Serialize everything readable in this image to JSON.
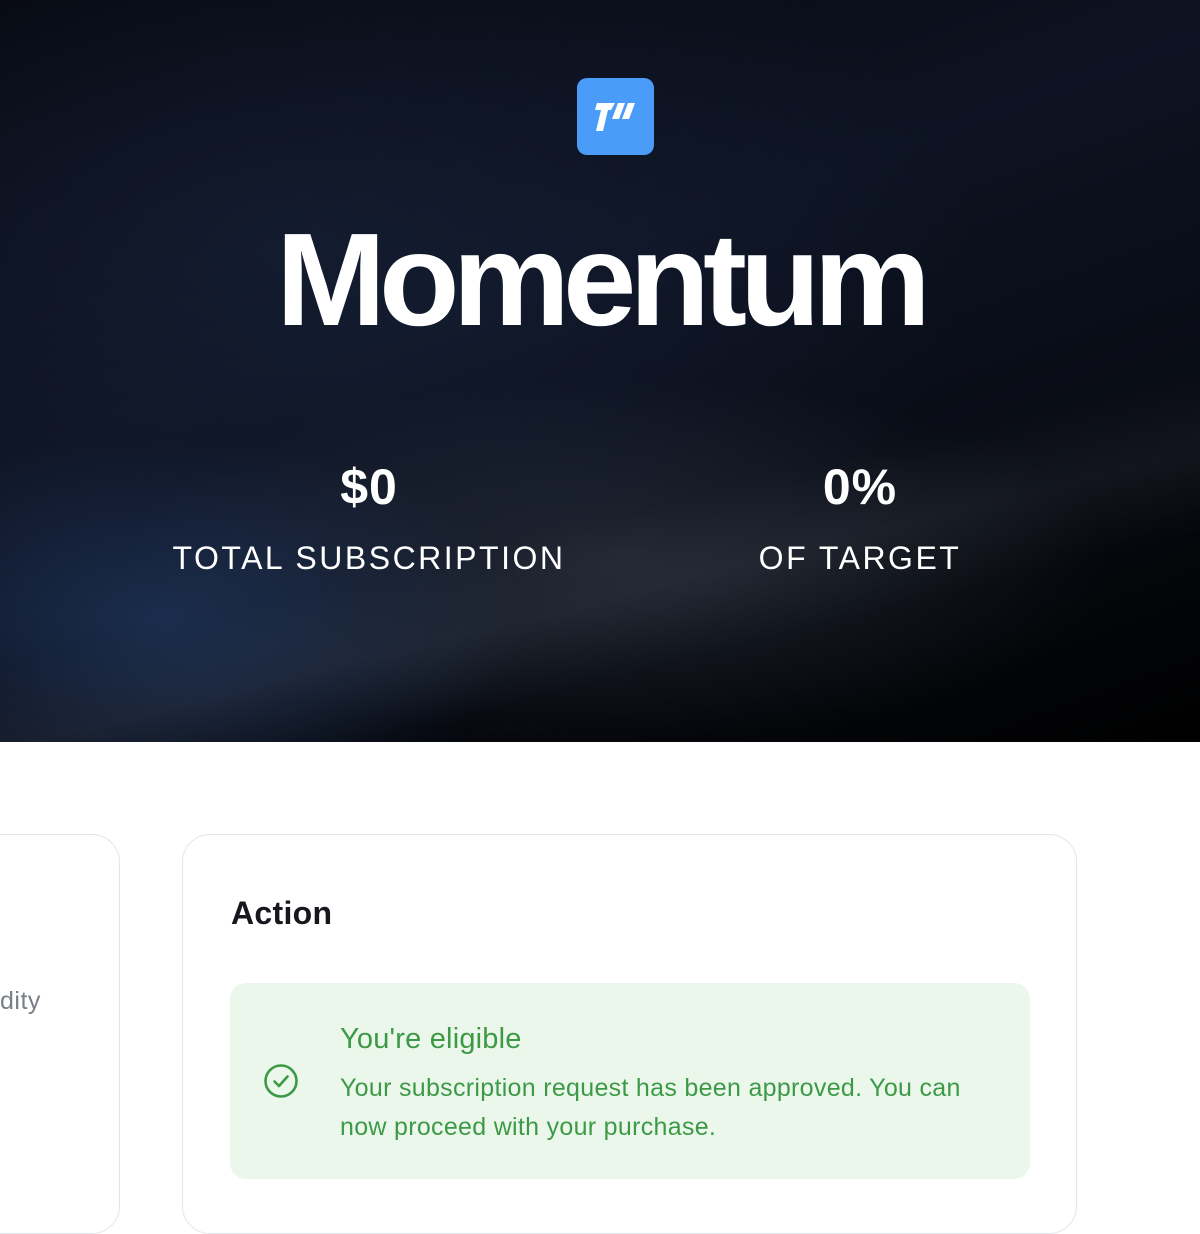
{
  "hero": {
    "logo_icon": "momentum-logo-icon",
    "title": "Momentum",
    "stats": [
      {
        "value": "$0",
        "label": "TOTAL SUBSCRIPTION"
      },
      {
        "value": "0%",
        "label": "OF TARGET"
      }
    ]
  },
  "left_card": {
    "fragment_text": "dity"
  },
  "action_card": {
    "title": "Action",
    "alert": {
      "icon": "check-circle-icon",
      "title": "You're eligible",
      "message": "Your subscription request has been approved. You can now proceed with your purchase."
    }
  },
  "colors": {
    "accent": "#4a9cf8",
    "success": "#3c9a47",
    "success_bg": "#ecf7ec"
  }
}
